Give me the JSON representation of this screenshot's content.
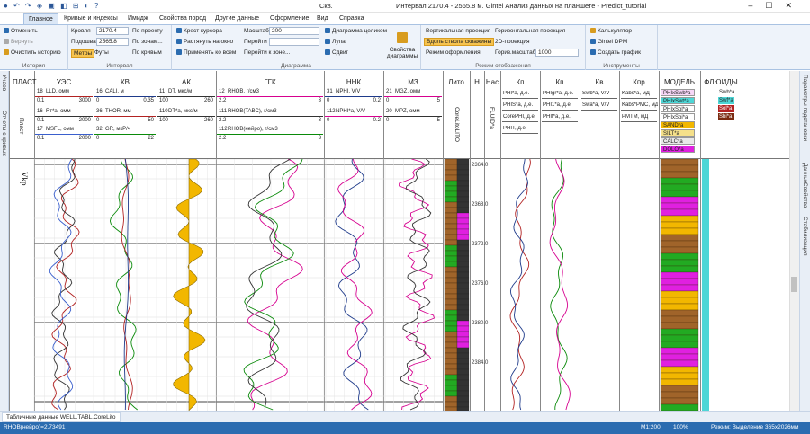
{
  "window": {
    "doc_title": "Скв.",
    "app_title": "Интервал 2170.4 - 2565.8 м. Gintel Анализ данных на планшете - Predict_tutorial"
  },
  "tabs": [
    "Главное",
    "Кривые и индексы",
    "Имидж",
    "Свойства пород",
    "Другие данные",
    "Оформление",
    "Вид",
    "Справка"
  ],
  "ribbon": {
    "history": {
      "caption": "История",
      "undo": "Отменить",
      "redo": "Вернуть",
      "clear": "Очистить историю"
    },
    "interval": {
      "caption": "Интервал",
      "roof_label": "Кровля",
      "roof_value": "2170.4",
      "sole_label": "Подошва",
      "sole_value": "2565.8",
      "by_project": "По проекту",
      "by_zones": "По зонам...",
      "by_curves": "По кривым",
      "unit_m": "Метры",
      "unit_ft": "Футы"
    },
    "diagram": {
      "caption": "Диаграмма",
      "cross": "Крест курсора",
      "stretch": "Растянуть на окно",
      "apply_all": "Применять ко всем",
      "scale_label": "Масштаб",
      "scale_value": "200",
      "goto": "Перейти",
      "goto_zone": "Перейти к зоне...",
      "whole": "Диаграмма целиком",
      "loupe": "Лупа",
      "shift": "Сдвиг",
      "props": "Свойства диаграммы"
    },
    "display": {
      "caption": "Режим отображения",
      "vertical": "Вертикальная проекция",
      "horizontal": "Горизонтальная проекция",
      "along": "Вдоль ствола скважины",
      "proj2d": "2D-проекция",
      "mode_label": "Режим оформления",
      "hscale_label": "Гориз.масштаб",
      "hscale_value": "1000"
    },
    "tools": {
      "caption": "Инструменты",
      "calc": "Калькулятор",
      "dpm": "Gintel DPM",
      "create": "Создать график"
    }
  },
  "side_left": [
    "Учаев",
    "Отчеты с кривых"
  ],
  "side_right": [
    "Параметры подстановки",
    "Данные",
    "Свойства",
    "Стабилизация"
  ],
  "header": {
    "plast_label": "ПЛАСТ",
    "plast_vertical": "Пласт",
    "tracks": [
      {
        "name": "УЭС",
        "curves": [
          {
            "idx": "18",
            "nm": "LLD, омм",
            "lo": "0.1",
            "hi": "3000",
            "color": "#b22222"
          },
          {
            "idx": "16",
            "nm": "Rт*a, омм",
            "lo": "0.1",
            "hi": "2000",
            "color": "#333333"
          },
          {
            "idx": "17",
            "nm": "MSFL, омм",
            "lo": "0.1",
            "hi": "2000",
            "color": "#3a5fcd"
          }
        ]
      },
      {
        "name": "КВ",
        "curves": [
          {
            "idx": "16",
            "nm": "CALI, м",
            "lo": "0",
            "hi": "0.35",
            "color": "#1e3a8a"
          },
          {
            "idx": "36",
            "nm": "THOR, мм",
            "lo": "0",
            "hi": "50",
            "color": "#b22222"
          },
          {
            "idx": "32",
            "nm": "GR, мкР/ч",
            "lo": "0",
            "hi": "22",
            "color": "#0a8a0a"
          }
        ]
      },
      {
        "name": "АК",
        "curves": [
          {
            "idx": "11",
            "nm": "DT, мкс/м",
            "lo": "100",
            "hi": "260",
            "color": "#333333"
          },
          {
            "idx": "110",
            "nm": "DT*a, мкс/м",
            "lo": "100",
            "hi": "260",
            "color": "#333333"
          }
        ]
      },
      {
        "name": "ГГК",
        "curves": [
          {
            "idx": "12",
            "nm": "RHOB, г/см3",
            "lo": "2.2",
            "hi": "3",
            "color": "#d6008f"
          },
          {
            "idx": "111",
            "nm": "RHOB(TABC), г/см3",
            "lo": "2.2",
            "hi": "3",
            "color": "#333333"
          },
          {
            "idx": "112",
            "nm": "RHOB(нейро), г/см3",
            "lo": "2.2",
            "hi": "3",
            "color": "#0a8a0a"
          }
        ]
      },
      {
        "name": "ННК",
        "curves": [
          {
            "idx": "31",
            "nm": "NPHI, V/V",
            "lo": "0",
            "hi": "0.2",
            "color": "#1e3a8a"
          },
          {
            "idx": "112",
            "nm": "NPHI*a, V/V",
            "lo": "0",
            "hi": "0.2",
            "color": "#d6008f"
          }
        ]
      },
      {
        "name": "МЗ",
        "curves": [
          {
            "idx": "21",
            "nm": "MGZ, омм",
            "lo": "0",
            "hi": "5",
            "color": "#d6008f"
          },
          {
            "idx": "20",
            "nm": "MPZ, омм",
            "lo": "0",
            "hi": "5",
            "color": "#333333"
          }
        ]
      }
    ],
    "lito": "Лито",
    "lito_sub": "CoreLitoLITO",
    "n": "Н",
    "nas": "Нас",
    "nas_sub": "FLUID*a",
    "kp1": {
      "name": "Кп",
      "curves": [
        "PHI*a, д.е.",
        "PHIS*a, д.е.",
        "CorePHI, д.е.",
        "PHIT, д.е."
      ]
    },
    "kp2": {
      "name": "Кп",
      "curves": [
        "PHIgr*a, д.е.",
        "PHI1*a, д.е.",
        "PHIf*a, д.е."
      ]
    },
    "kv": {
      "name": "Кв",
      "curves": [
        "Swb*a, V/V",
        "Swa*a, V/V"
      ]
    },
    "kpr": {
      "name": "Кпр",
      "curves": [
        "Kabs*a, мД",
        "Kabs*PMC, мД",
        "PMTM, мД"
      ]
    },
    "model": {
      "name": "МОДЕЛЬ",
      "items": [
        "PHIxSwb*a",
        "PHIxSwt*a",
        "PHIxSol*a",
        "PHIxSbi*a",
        "SAND*a",
        "SILT*a",
        "CALC*a",
        "DOLO*a"
      ]
    },
    "fluids": {
      "name": "ФЛЮИДЫ",
      "items": [
        "Swb*a",
        "Swf*a",
        "Sol*a",
        "Sbi*a"
      ]
    }
  },
  "depth_labels": [
    "2364.0",
    "2368.0",
    "2372.0",
    "2376.0",
    "2380.0",
    "2384.0"
  ],
  "zone_label": "Vkp",
  "status": {
    "tab": "Табличные данные WELL.TABL.CoreLito",
    "cursor": "RHOB(нейро)=2.73491",
    "scale": "М1:200",
    "zoom": "100%",
    "mode": "Режим: Выделение",
    "size": "365x2026мм"
  },
  "colors": {
    "accent": "#2b6cb0",
    "ribbon": "#eef3fa",
    "sand": "#f2b700",
    "green": "#22aa22",
    "brick": "#a0642a",
    "magenta": "#e020e0"
  }
}
